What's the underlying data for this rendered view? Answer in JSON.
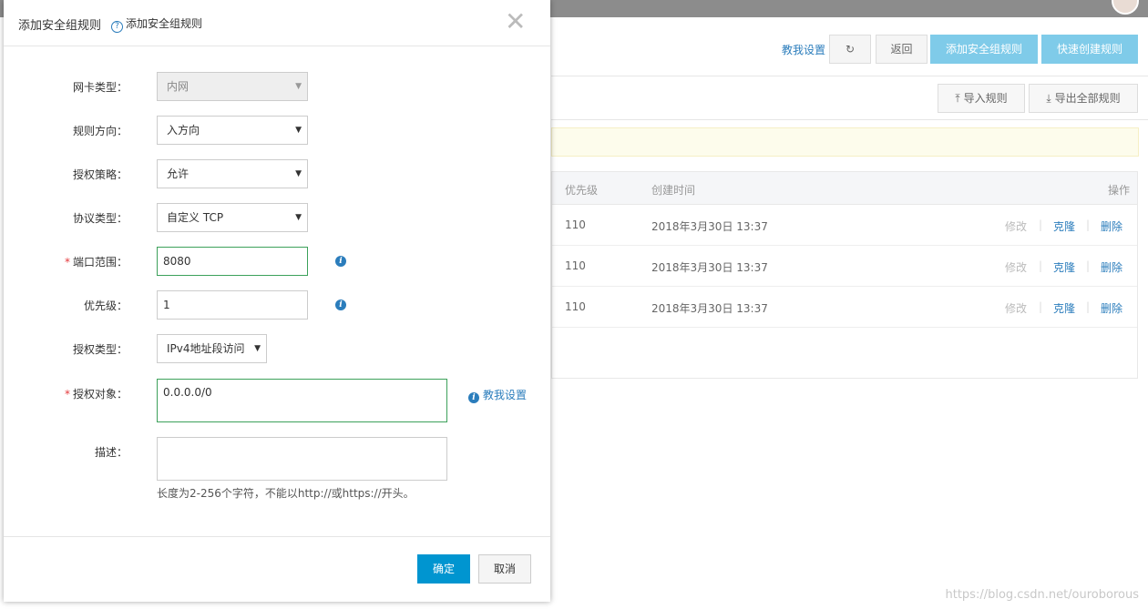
{
  "background": {
    "teach_link": "教我设置",
    "refresh_icon": "refresh-icon",
    "back_button": "返回",
    "add_rule_button": "添加安全组规则",
    "quick_create_button": "快速创建规则",
    "import_button": "导入规则",
    "export_button": "导出全部规则",
    "table": {
      "headers": {
        "priority": "优先级",
        "created": "创建时间",
        "actions": "操作"
      },
      "rows": [
        {
          "priority": "110",
          "created": "2018年3月30日 13:37",
          "edit": "修改",
          "clone": "克隆",
          "delete": "删除"
        },
        {
          "priority": "110",
          "created": "2018年3月30日 13:37",
          "edit": "修改",
          "clone": "克隆",
          "delete": "删除"
        },
        {
          "priority": "110",
          "created": "2018年3月30日 13:37",
          "edit": "修改",
          "clone": "克隆",
          "delete": "删除"
        }
      ]
    },
    "watermark": "https://blog.csdn.net/ouroborous"
  },
  "dialog": {
    "title": "添加安全组规则",
    "help_text": "添加安全组规则",
    "fields": {
      "nic_type": {
        "label": "网卡类型：",
        "value": "内网"
      },
      "direction": {
        "label": "规则方向：",
        "value": "入方向"
      },
      "policy": {
        "label": "授权策略：",
        "value": "允许"
      },
      "protocol": {
        "label": "协议类型：",
        "value": "自定义 TCP"
      },
      "port_range": {
        "label": "端口范围：",
        "value": "8080"
      },
      "priority": {
        "label": "优先级：",
        "value": "1"
      },
      "auth_type": {
        "label": "授权类型：",
        "value": "IPv4地址段访问"
      },
      "auth_object": {
        "label": "授权对象：",
        "value": "0.0.0.0/0"
      },
      "description": {
        "label": "描述：",
        "value": ""
      }
    },
    "teach_link": "教我设置",
    "hint": "长度为2-256个字符，不能以http://或https://开头。",
    "ok_button": "确定",
    "cancel_button": "取消",
    "colors": {
      "primary": "#0095d0",
      "link": "#2b7dbc",
      "active_border": "#3ca15a",
      "required": "#e4393c"
    }
  }
}
